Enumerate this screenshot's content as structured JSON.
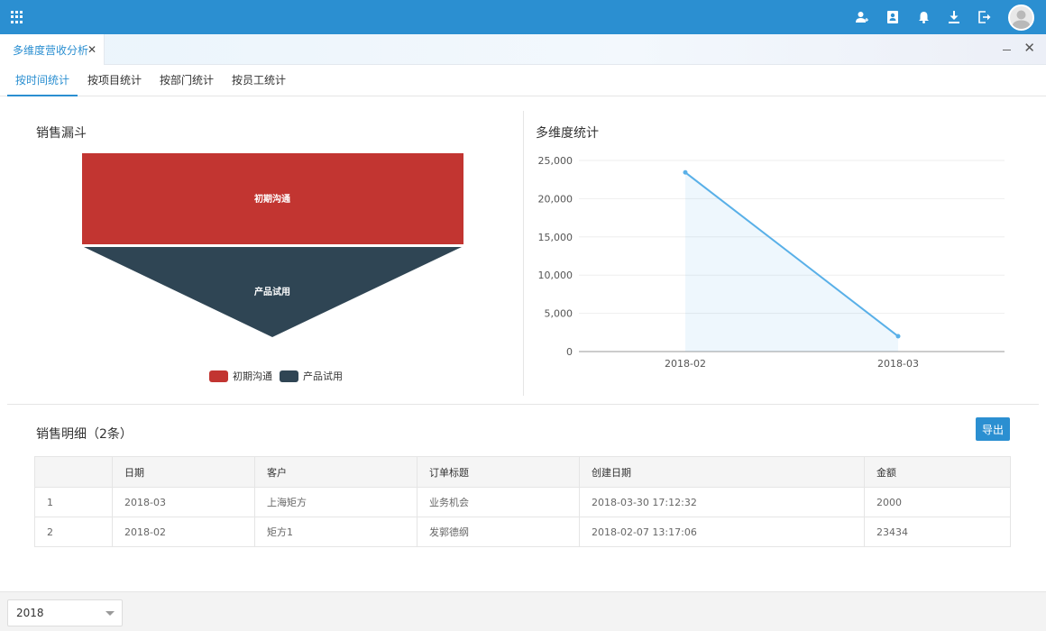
{
  "tab": {
    "title": "多维度营收分析",
    "close": "✕"
  },
  "subtabs": [
    "按时间统计",
    "按项目统计",
    "按部门统计",
    "按员工统计"
  ],
  "funnel": {
    "title": "销售漏斗",
    "stages": [
      {
        "name": "初期沟通",
        "color": "#c23531"
      },
      {
        "name": "产品试用",
        "color": "#2f4554"
      }
    ]
  },
  "chart_data": {
    "type": "area",
    "title": "多维度统计",
    "categories": [
      "2018-02",
      "2018-03"
    ],
    "values": [
      23434,
      2000
    ],
    "ylim": [
      0,
      25000
    ],
    "yticks": [
      "0",
      "5,000",
      "10,000",
      "15,000",
      "20,000",
      "25,000"
    ],
    "color": "#59b0e8",
    "grid": true
  },
  "detail": {
    "title": "销售明细（2条）",
    "export_label": "导出",
    "headers": [
      "",
      "日期",
      "客户",
      "订单标题",
      "创建日期",
      "金额"
    ],
    "rows": [
      [
        "1",
        "2018-03",
        "上海矩方",
        "业务机会",
        "2018-03-30 17:12:32",
        "2000"
      ],
      [
        "2",
        "2018-02",
        "矩方1",
        "发郭德纲",
        "2018-02-07 13:17:06",
        "23434"
      ]
    ]
  },
  "footer": {
    "year": "2018"
  },
  "colors": {
    "brand": "#2b8fd1"
  }
}
